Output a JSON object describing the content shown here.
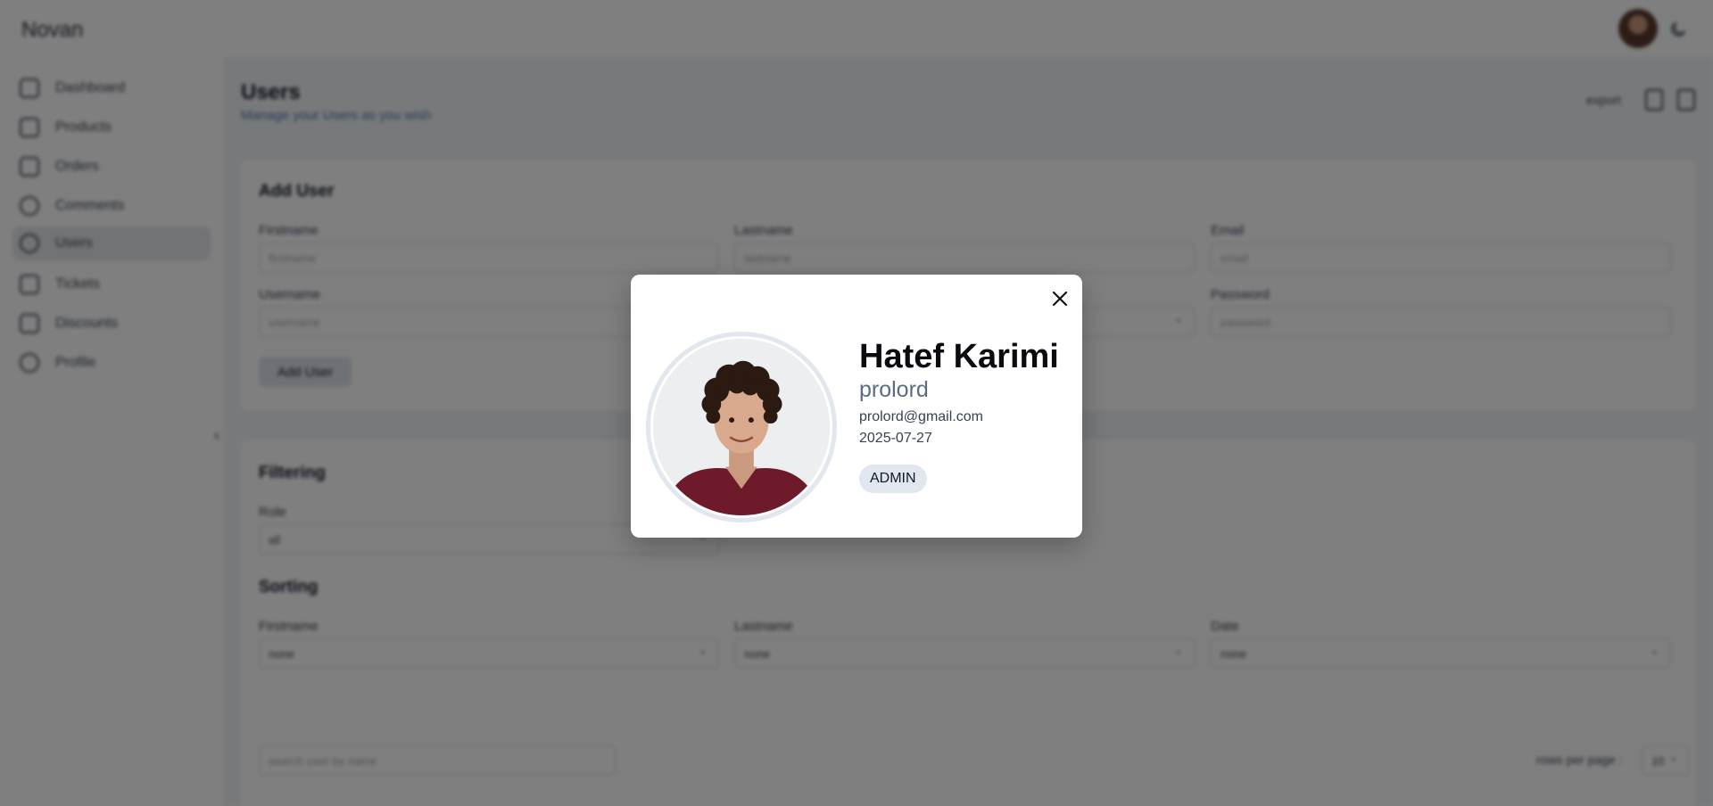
{
  "app": {
    "logo": "Novan"
  },
  "sidebar": {
    "items": [
      {
        "label": "Dashboard",
        "icon": "dashboard-icon"
      },
      {
        "label": "Products",
        "icon": "products-icon"
      },
      {
        "label": "Orders",
        "icon": "orders-icon"
      },
      {
        "label": "Comments",
        "icon": "comments-icon"
      },
      {
        "label": "Users",
        "icon": "users-icon",
        "active": true
      },
      {
        "label": "Tickets",
        "icon": "tickets-icon"
      },
      {
        "label": "Discounts",
        "icon": "discounts-icon"
      },
      {
        "label": "Profile",
        "icon": "profile-icon"
      }
    ]
  },
  "header": {
    "title": "Users",
    "subtitle": "Manage your Users as you wish",
    "export_label": "export"
  },
  "add_user": {
    "title": "Add User",
    "firstname_label": "Firstname",
    "firstname_placeholder": "firstname",
    "lastname_label": "Lastname",
    "lastname_placeholder": "lastname",
    "email_label": "Email",
    "email_placeholder": "email",
    "username_label": "Username",
    "username_placeholder": "username",
    "password_label": "Password",
    "password_placeholder": "password",
    "submit_label": "Add User"
  },
  "filtering": {
    "title": "Filtering",
    "role_label": "Role",
    "role_value": "all"
  },
  "sorting": {
    "title": "Sorting",
    "firstname_label": "Firstname",
    "firstname_value": "none",
    "lastname_label": "Lastname",
    "lastname_value": "none",
    "date_label": "Date",
    "date_value": "none"
  },
  "table": {
    "search_placeholder": "search user by name",
    "rows_per_page_label": "rows per page :",
    "rows_per_page_value": "10"
  },
  "modal": {
    "name": "Hatef Karimi",
    "username": "prolord",
    "email": "prolord@gmail.com",
    "date": "2025-07-27",
    "role": "ADMIN"
  },
  "colors": {
    "overlay": "#00000080",
    "badge_bg": "#e2e6ee",
    "username_text": "#5b6b84",
    "subtitle_text": "#4b74a6"
  }
}
